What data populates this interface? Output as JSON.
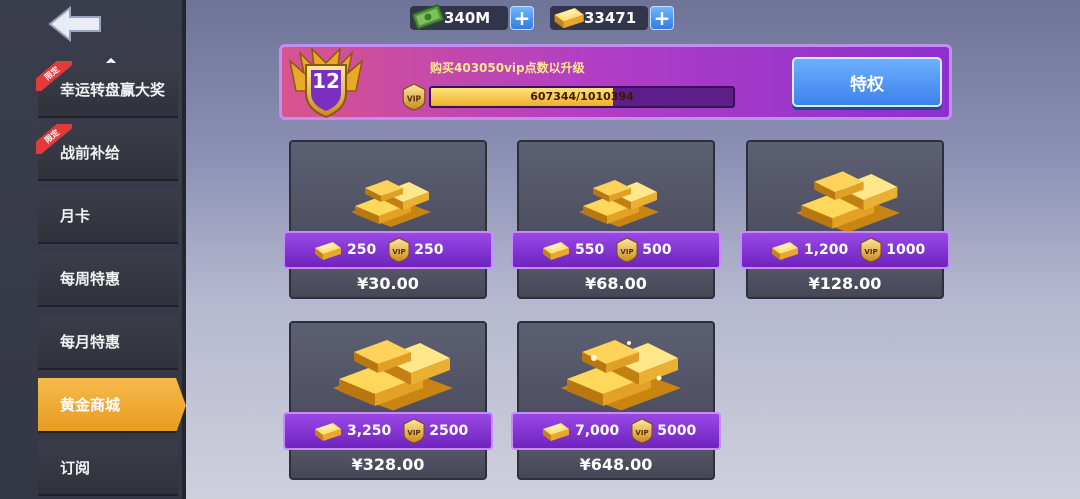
{
  "currency": {
    "cash": "340M",
    "gold": "33471"
  },
  "sidebar": {
    "items": [
      {
        "label": "幸运转盘赢大奖",
        "tag": "限定"
      },
      {
        "label": "战前补给",
        "tag": "限定"
      },
      {
        "label": "月卡"
      },
      {
        "label": "每周特惠"
      },
      {
        "label": "每月特惠"
      },
      {
        "label": "黄金商城",
        "active": true
      },
      {
        "label": "订阅"
      }
    ]
  },
  "vip": {
    "level": "12",
    "message": "购买403050vip点数以升级",
    "progress_text": "607344/1010394",
    "progress_fraction": 0.601,
    "privilege_label": "特权"
  },
  "products": [
    {
      "gold": "250",
      "vip": "250",
      "price": "¥30.00"
    },
    {
      "gold": "550",
      "vip": "500",
      "price": "¥68.00"
    },
    {
      "gold": "1,200",
      "vip": "1000",
      "price": "¥128.00"
    },
    {
      "gold": "3,250",
      "vip": "2500",
      "price": "¥328.00"
    },
    {
      "gold": "7,000",
      "vip": "5000",
      "price": "¥648.00"
    }
  ],
  "colors": {
    "accent_gold": "#f0ae2a",
    "vip_purple": "#8d2fd0",
    "button_blue": "#3c82ea"
  }
}
